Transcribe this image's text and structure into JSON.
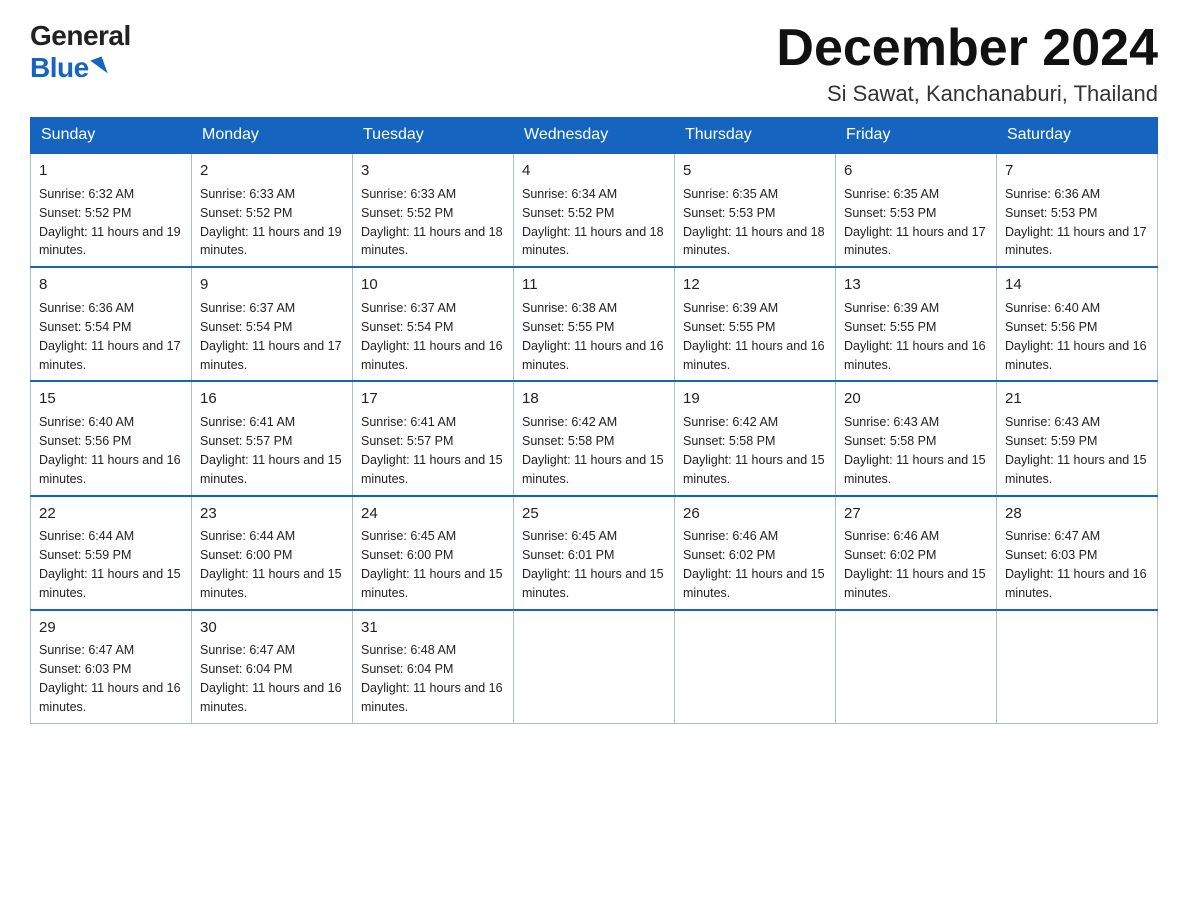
{
  "logo": {
    "general": "General",
    "blue": "Blue"
  },
  "title": "December 2024",
  "location": "Si Sawat, Kanchanaburi, Thailand",
  "days_of_week": [
    "Sunday",
    "Monday",
    "Tuesday",
    "Wednesday",
    "Thursday",
    "Friday",
    "Saturday"
  ],
  "weeks": [
    [
      {
        "day": "1",
        "sunrise": "6:32 AM",
        "sunset": "5:52 PM",
        "daylight": "11 hours and 19 minutes."
      },
      {
        "day": "2",
        "sunrise": "6:33 AM",
        "sunset": "5:52 PM",
        "daylight": "11 hours and 19 minutes."
      },
      {
        "day": "3",
        "sunrise": "6:33 AM",
        "sunset": "5:52 PM",
        "daylight": "11 hours and 18 minutes."
      },
      {
        "day": "4",
        "sunrise": "6:34 AM",
        "sunset": "5:52 PM",
        "daylight": "11 hours and 18 minutes."
      },
      {
        "day": "5",
        "sunrise": "6:35 AM",
        "sunset": "5:53 PM",
        "daylight": "11 hours and 18 minutes."
      },
      {
        "day": "6",
        "sunrise": "6:35 AM",
        "sunset": "5:53 PM",
        "daylight": "11 hours and 17 minutes."
      },
      {
        "day": "7",
        "sunrise": "6:36 AM",
        "sunset": "5:53 PM",
        "daylight": "11 hours and 17 minutes."
      }
    ],
    [
      {
        "day": "8",
        "sunrise": "6:36 AM",
        "sunset": "5:54 PM",
        "daylight": "11 hours and 17 minutes."
      },
      {
        "day": "9",
        "sunrise": "6:37 AM",
        "sunset": "5:54 PM",
        "daylight": "11 hours and 17 minutes."
      },
      {
        "day": "10",
        "sunrise": "6:37 AM",
        "sunset": "5:54 PM",
        "daylight": "11 hours and 16 minutes."
      },
      {
        "day": "11",
        "sunrise": "6:38 AM",
        "sunset": "5:55 PM",
        "daylight": "11 hours and 16 minutes."
      },
      {
        "day": "12",
        "sunrise": "6:39 AM",
        "sunset": "5:55 PM",
        "daylight": "11 hours and 16 minutes."
      },
      {
        "day": "13",
        "sunrise": "6:39 AM",
        "sunset": "5:55 PM",
        "daylight": "11 hours and 16 minutes."
      },
      {
        "day": "14",
        "sunrise": "6:40 AM",
        "sunset": "5:56 PM",
        "daylight": "11 hours and 16 minutes."
      }
    ],
    [
      {
        "day": "15",
        "sunrise": "6:40 AM",
        "sunset": "5:56 PM",
        "daylight": "11 hours and 16 minutes."
      },
      {
        "day": "16",
        "sunrise": "6:41 AM",
        "sunset": "5:57 PM",
        "daylight": "11 hours and 15 minutes."
      },
      {
        "day": "17",
        "sunrise": "6:41 AM",
        "sunset": "5:57 PM",
        "daylight": "11 hours and 15 minutes."
      },
      {
        "day": "18",
        "sunrise": "6:42 AM",
        "sunset": "5:58 PM",
        "daylight": "11 hours and 15 minutes."
      },
      {
        "day": "19",
        "sunrise": "6:42 AM",
        "sunset": "5:58 PM",
        "daylight": "11 hours and 15 minutes."
      },
      {
        "day": "20",
        "sunrise": "6:43 AM",
        "sunset": "5:58 PM",
        "daylight": "11 hours and 15 minutes."
      },
      {
        "day": "21",
        "sunrise": "6:43 AM",
        "sunset": "5:59 PM",
        "daylight": "11 hours and 15 minutes."
      }
    ],
    [
      {
        "day": "22",
        "sunrise": "6:44 AM",
        "sunset": "5:59 PM",
        "daylight": "11 hours and 15 minutes."
      },
      {
        "day": "23",
        "sunrise": "6:44 AM",
        "sunset": "6:00 PM",
        "daylight": "11 hours and 15 minutes."
      },
      {
        "day": "24",
        "sunrise": "6:45 AM",
        "sunset": "6:00 PM",
        "daylight": "11 hours and 15 minutes."
      },
      {
        "day": "25",
        "sunrise": "6:45 AM",
        "sunset": "6:01 PM",
        "daylight": "11 hours and 15 minutes."
      },
      {
        "day": "26",
        "sunrise": "6:46 AM",
        "sunset": "6:02 PM",
        "daylight": "11 hours and 15 minutes."
      },
      {
        "day": "27",
        "sunrise": "6:46 AM",
        "sunset": "6:02 PM",
        "daylight": "11 hours and 15 minutes."
      },
      {
        "day": "28",
        "sunrise": "6:47 AM",
        "sunset": "6:03 PM",
        "daylight": "11 hours and 16 minutes."
      }
    ],
    [
      {
        "day": "29",
        "sunrise": "6:47 AM",
        "sunset": "6:03 PM",
        "daylight": "11 hours and 16 minutes."
      },
      {
        "day": "30",
        "sunrise": "6:47 AM",
        "sunset": "6:04 PM",
        "daylight": "11 hours and 16 minutes."
      },
      {
        "day": "31",
        "sunrise": "6:48 AM",
        "sunset": "6:04 PM",
        "daylight": "11 hours and 16 minutes."
      },
      null,
      null,
      null,
      null
    ]
  ]
}
